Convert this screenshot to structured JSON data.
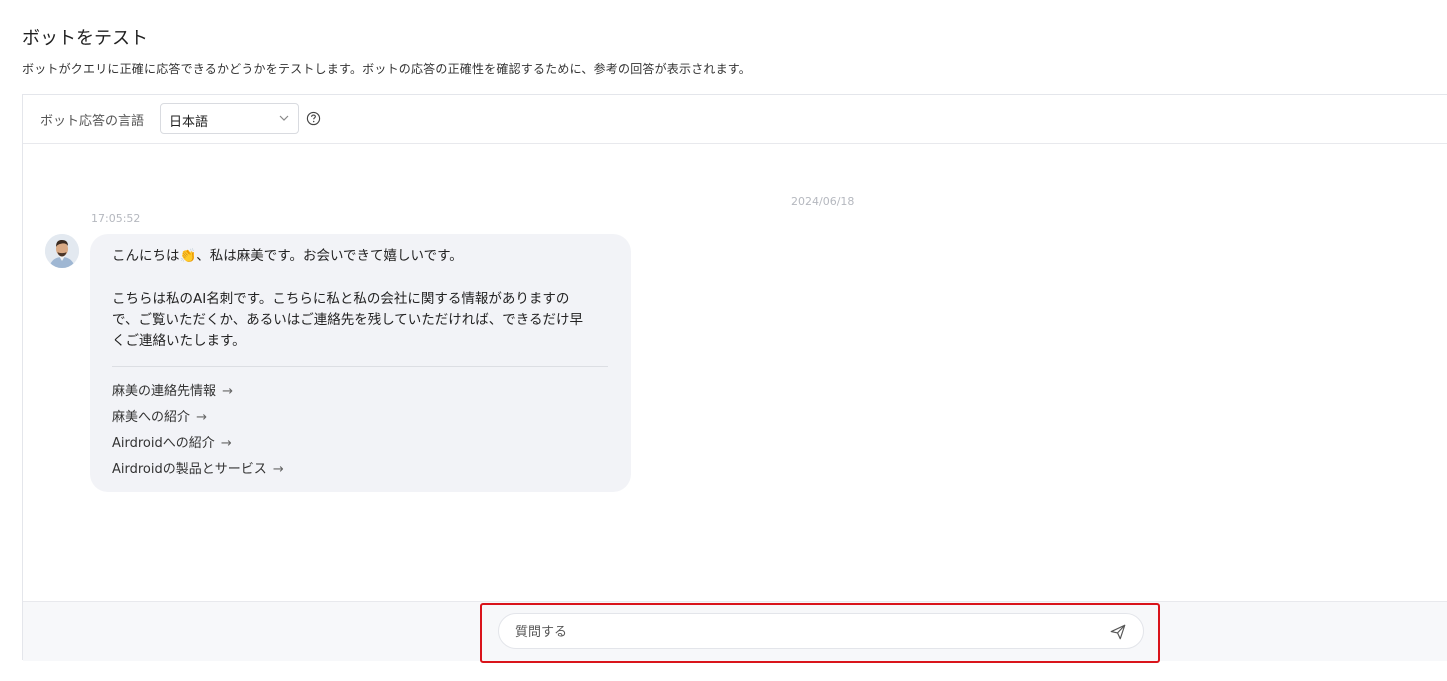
{
  "page": {
    "title": "ボットをテスト",
    "description": "ボットがクエリに正確に応答できるかどうかをテストします。ボットの応答の正確性を確認するために、参考の回答が表示されます。"
  },
  "toolbar": {
    "language_label": "ボット応答の言語",
    "language_value": "日本語",
    "help_icon": "question-circle-icon"
  },
  "chat": {
    "date": "2024/06/18",
    "messages": [
      {
        "time": "17:05:52",
        "avatar": "user-avatar",
        "lines": [
          "こんにちは👏、私は麻美です。お会いできて嬉しいです。",
          "こちらは私のAI名刺です。こちらに私と私の会社に関する情報がありますの",
          "で、ご覧いただくか、あるいはご連絡先を残していただければ、できるだけ早",
          "くご連絡いたします。"
        ],
        "links": [
          "麻美の連絡先情報",
          "麻美への紹介",
          "Airdroidへの紹介",
          "Airdroidの製品とサービス"
        ],
        "link_arrow": "→"
      }
    ]
  },
  "composer": {
    "placeholder": "質問する",
    "value": "",
    "send_icon": "send-icon",
    "highlight_color": "#d9141b"
  }
}
